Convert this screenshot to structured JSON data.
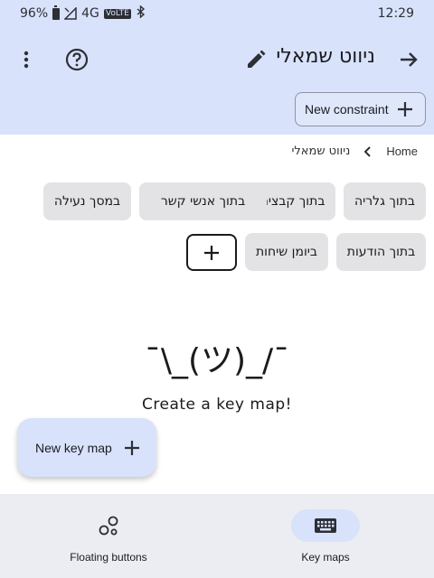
{
  "status_bar": {
    "battery_pct": "96%",
    "network": "4G",
    "lte": "VoLTE",
    "time": "12:29"
  },
  "app_bar": {
    "title": "ניווט שמאלי",
    "new_constraint_label": "New constraint"
  },
  "breadcrumb": {
    "home": "Home",
    "current": "ניווט שמאלי"
  },
  "chips": [
    {
      "label": "בתוך גלריה"
    },
    {
      "label": "בתוך קבצים"
    },
    {
      "label": "בתוך אנשי קשר"
    },
    {
      "label": "במסך נעילה"
    },
    {
      "label": "בתוך הודעות"
    },
    {
      "label": "ביומן שיחות"
    }
  ],
  "empty_state": {
    "shrug": "¯\\_(ツ)_/¯",
    "message": "Create a key map!"
  },
  "fab": {
    "label": "New key map"
  },
  "bottom_nav": {
    "items": [
      {
        "label": "Floating buttons",
        "icon": "floating-buttons-icon",
        "selected": false
      },
      {
        "label": "Key maps",
        "icon": "keyboard-icon",
        "selected": true
      }
    ]
  },
  "colors": {
    "app_bar_bg": "#d8e2fb",
    "chip_bg": "#e3e3e6",
    "nav_bg": "#ecedf3"
  }
}
